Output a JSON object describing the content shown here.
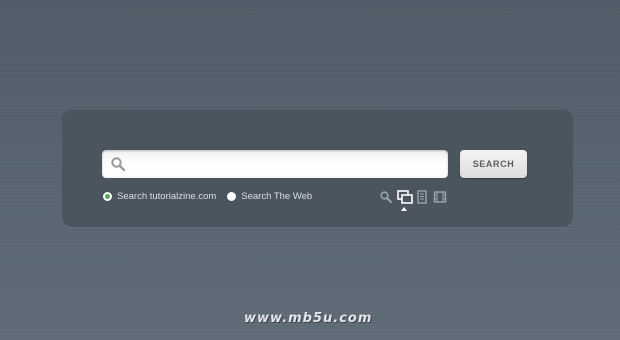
{
  "search": {
    "value": "",
    "placeholder": "",
    "button_label": "SEARCH"
  },
  "scope_options": [
    {
      "label": "Search tutorialzine.com",
      "selected": true
    },
    {
      "label": "Search The Web",
      "selected": false
    }
  ],
  "search_types": [
    {
      "icon": "magnifier-icon",
      "selected": false
    },
    {
      "icon": "images-icon",
      "selected": true
    },
    {
      "icon": "news-icon",
      "selected": false
    },
    {
      "icon": "video-icon",
      "selected": false
    }
  ],
  "watermark": "www.mb5u.com",
  "colors": {
    "background": "#56636e",
    "panel": "#4a5560",
    "radio_selected": "#4caf50"
  }
}
